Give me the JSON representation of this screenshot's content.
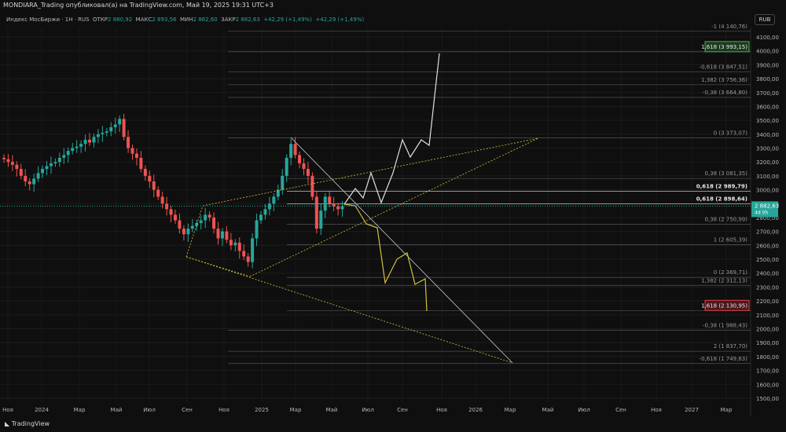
{
  "header": {
    "publisher": "MONDIARA_Trading опубликовал(а) на TradingView.com, Май 19, 2025 19:31 UTC+3"
  },
  "legend": {
    "symbol": "Индекс МосБиржи · 1H · RUS",
    "open_label": "ОТКР",
    "open": "2 880,92",
    "high_label": "МАКС",
    "high": "2 893,56",
    "low_label": "МИН",
    "low": "2 862,60",
    "close_label": "ЗАКР",
    "close": "2 882,63",
    "change1": "+42,29 (+1,49%)",
    "change2": "+42,29 (+1,49%)"
  },
  "currency": "RUB",
  "footer": {
    "brand": "TradingView"
  },
  "colors": {
    "up": "#26a69a",
    "down": "#ef5350",
    "bg": "#0f0f0f",
    "fib_yellow": "#d4c13a"
  },
  "chart_data": {
    "type": "candlestick",
    "ylim": [
      1450,
      4180
    ],
    "yticks": [
      4100,
      4000,
      3900,
      3800,
      3700,
      3600,
      3500,
      3400,
      3300,
      3200,
      3100,
      3000,
      2900,
      2800,
      2700,
      2600,
      2500,
      2400,
      2300,
      2200,
      2100,
      2000,
      1900,
      1800,
      1700,
      1600,
      1500
    ],
    "ytick_labels": [
      "4100,00",
      "4000,00",
      "3900,00",
      "3800,00",
      "3700,00",
      "3600,00",
      "3500,00",
      "3400,00",
      "3300,00",
      "3200,00",
      "3100,00",
      "3000,00",
      "2900,00",
      "2800,00",
      "2700,00",
      "2600,00",
      "2500,00",
      "2400,00",
      "2300,00",
      "2200,00",
      "2100,00",
      "2000,00",
      "1900,00",
      "1800,00",
      "1700,00",
      "1600,00",
      "1500,00"
    ],
    "xticks": [
      "Ноя",
      "2024",
      "Мар",
      "Май",
      "Июл",
      "Сен",
      "Ноя",
      "2025",
      "Мар",
      "Май",
      "Июл",
      "Сен",
      "Ноя",
      "2026",
      "Мар",
      "Май",
      "Июл",
      "Сен",
      "Ноя",
      "2027",
      "Мар"
    ],
    "closes": [
      3220,
      3200,
      3180,
      3150,
      3100,
      3060,
      3040,
      3080,
      3120,
      3150,
      3170,
      3190,
      3200,
      3230,
      3250,
      3280,
      3300,
      3310,
      3330,
      3360,
      3340,
      3380,
      3400,
      3410,
      3420,
      3450,
      3470,
      3510,
      3380,
      3300,
      3260,
      3230,
      3150,
      3100,
      3060,
      3000,
      2950,
      2900,
      2860,
      2820,
      2780,
      2720,
      2680,
      2720,
      2740,
      2760,
      2780,
      2820,
      2800,
      2720,
      2650,
      2700,
      2640,
      2600,
      2620,
      2560,
      2520,
      2480,
      2650,
      2780,
      2820,
      2860,
      2900,
      2950,
      3000,
      3100,
      3230,
      3330,
      3250,
      3190,
      3150,
      3100,
      2950,
      2720,
      2850,
      2950,
      2900,
      2880,
      2860,
      2882
    ],
    "last_price": {
      "value": "2 882,63",
      "countdown": "4d 0h"
    },
    "fib_levels": [
      {
        "label": "-1 (4 140,76)",
        "price": 4140.76
      },
      {
        "label": "1,618 (3 993,15)",
        "price": 3993.15,
        "highlight": "green"
      },
      {
        "label": "-0,618 (3 847,51)",
        "price": 3847.51
      },
      {
        "label": "1,382 (3 756,36)",
        "price": 3756.36
      },
      {
        "label": "-0,38 (3 664,80)",
        "price": 3664.8
      },
      {
        "label": "0 (3 373,07)",
        "price": 3373.07
      },
      {
        "label": "0,38 (3 081,35)",
        "price": 3081.35
      },
      {
        "label": "0,618 (2 989,79)",
        "price": 2989.79,
        "bold": true
      },
      {
        "label": "0,618 (2 898,64)",
        "price": 2898.64,
        "bold": true
      },
      {
        "label": "0,38 (2 750,99)",
        "price": 2750.99
      },
      {
        "label": "1 (2 605,39)",
        "price": 2605.39
      },
      {
        "label": "0 (2 369,71)",
        "price": 2369.71
      },
      {
        "label": "1,382 (2 312,13)",
        "price": 2312.13
      },
      {
        "label": "1,618 (2 130,95)",
        "price": 2130.95,
        "highlight": "red"
      },
      {
        "label": "-0,38 (1 988,43)",
        "price": 1988.43
      },
      {
        "label": "2 (1 837,70)",
        "price": 1837.7
      },
      {
        "label": "-0,618 (1 749,63)",
        "price": 1749.63
      }
    ]
  }
}
